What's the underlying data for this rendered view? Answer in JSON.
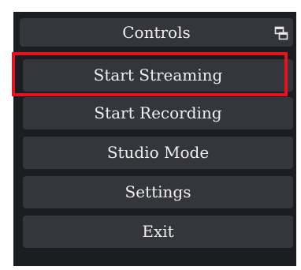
{
  "dock": {
    "title": "Controls",
    "undock_icon": "undock-float-icon"
  },
  "buttons": [
    {
      "label": "Start Streaming"
    },
    {
      "label": "Start Recording"
    },
    {
      "label": "Studio Mode"
    },
    {
      "label": "Settings"
    },
    {
      "label": "Exit"
    }
  ],
  "colors": {
    "panel_bg": "#1c1d21",
    "button_bg": "#35363c",
    "text": "#f0f0f0",
    "highlight": "#e8121e"
  }
}
